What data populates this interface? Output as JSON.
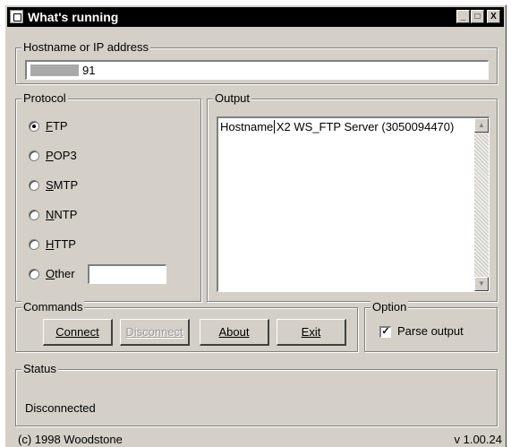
{
  "window": {
    "title": "What's running",
    "controls": {
      "minimize": "_",
      "maximize": "□",
      "close": "X"
    }
  },
  "host": {
    "label": "Hostname or IP address",
    "value": "91"
  },
  "protocol": {
    "label": "Protocol",
    "options": [
      {
        "key": "F",
        "rest": "TP",
        "selected": true
      },
      {
        "key": "P",
        "rest": "OP3",
        "selected": false
      },
      {
        "key": "S",
        "rest": "MTP",
        "selected": false
      },
      {
        "key": "N",
        "rest": "NTP",
        "selected": false
      },
      {
        "key": "H",
        "rest": "TTP",
        "selected": false
      },
      {
        "key": "O",
        "rest": "ther",
        "selected": false
      }
    ],
    "other_value": ""
  },
  "output": {
    "label": "Output",
    "text": "Hostname X2 WS_FTP Server (3050094470)"
  },
  "commands": {
    "label": "Commands",
    "connect": "Connect",
    "disconnect": "Disconnect",
    "about": "About",
    "exit": "Exit"
  },
  "option": {
    "label": "Option",
    "parse_output": "Parse output",
    "parse_checked": true
  },
  "status": {
    "label": "Status",
    "text": "Disconnected"
  },
  "footer": {
    "copyright": "(c) 1998 Woodstone",
    "version": "v 1.00.24"
  }
}
